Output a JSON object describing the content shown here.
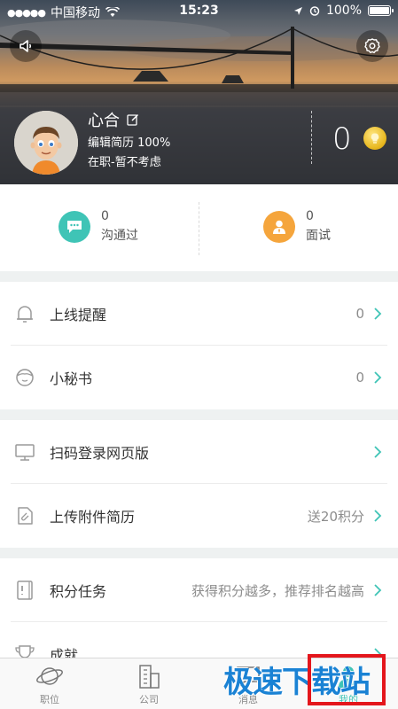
{
  "status_bar": {
    "signal": "●●●●●",
    "carrier": "中国移动",
    "time": "15:23",
    "battery": "100%"
  },
  "header": {
    "left_button_icon": "speaker-icon",
    "right_button_icon": "gear-icon"
  },
  "profile": {
    "name": "心合",
    "resume": "编辑简历 100%",
    "status": "在职-暂不考虑",
    "points": "0"
  },
  "stats": [
    {
      "count": "0",
      "label": "沟通过",
      "icon": "chat-bubble-icon",
      "color": "#3fc4b6"
    },
    {
      "count": "0",
      "label": "面试",
      "icon": "interviewer-icon",
      "color": "#f5a53c"
    }
  ],
  "menu": [
    {
      "label": "上线提醒",
      "value": "0",
      "icon": "bell-icon"
    },
    {
      "label": "小秘书",
      "value": "0",
      "icon": "secretary-icon"
    },
    {
      "label": "扫码登录网页版",
      "value": "",
      "icon": "monitor-icon"
    },
    {
      "label": "上传附件简历",
      "value": "送20积分",
      "icon": "attachment-icon"
    },
    {
      "label": "积分任务",
      "value": "获得积分越多，推荐排名越高",
      "icon": "task-icon"
    },
    {
      "label": "成就",
      "value": "",
      "icon": "trophy-icon"
    }
  ],
  "tabbar": [
    {
      "label": "职位",
      "icon": "planet-icon"
    },
    {
      "label": "公司",
      "icon": "building-icon"
    },
    {
      "label": "消息",
      "icon": "message-icon"
    },
    {
      "label": "我的",
      "icon": "person-icon"
    }
  ],
  "watermark": "极速下载站",
  "colors": {
    "accent": "#3fc4b6",
    "orange": "#f5a53c",
    "highlight_box": "#e4161c",
    "watermark": "#1a82d4"
  }
}
